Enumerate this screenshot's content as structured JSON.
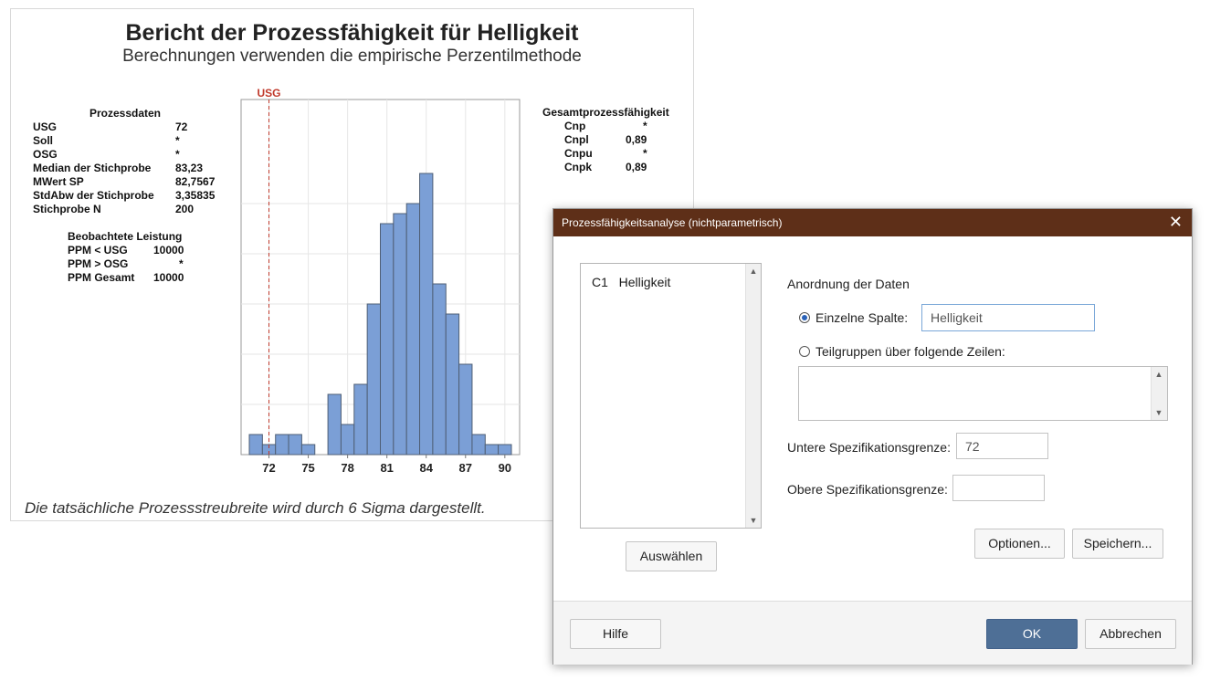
{
  "report": {
    "title": "Bericht der Prozessfähigkeit für Helligkeit",
    "subtitle": "Berechnungen verwenden die empirische Perzentilmethode",
    "process_data": {
      "header": "Prozessdaten",
      "rows": [
        {
          "label": "USG",
          "value": "72"
        },
        {
          "label": "Soll",
          "value": "*"
        },
        {
          "label": "OSG",
          "value": "*"
        },
        {
          "label": "Median der Stichprobe",
          "value": "83,23"
        },
        {
          "label": "MWert SP",
          "value": "82,7567"
        },
        {
          "label": "StdAbw der Stichprobe",
          "value": "3,35835"
        },
        {
          "label": "Stichprobe N",
          "value": "200"
        }
      ]
    },
    "observed": {
      "header": "Beobachtete Leistung",
      "rows": [
        {
          "label": "PPM < USG",
          "value": "10000"
        },
        {
          "label": "PPM > OSG",
          "value": "*"
        },
        {
          "label": "PPM Gesamt",
          "value": "10000"
        }
      ]
    },
    "capability": {
      "header": "Gesamtprozessfähigkeit",
      "rows": [
        {
          "label": "Cnp",
          "value": "*"
        },
        {
          "label": "Cnpl",
          "value": "0,89"
        },
        {
          "label": "Cnpu",
          "value": "*"
        },
        {
          "label": "Cnpk",
          "value": "0,89"
        }
      ]
    },
    "footnote": "Die tatsächliche Prozessstreubreite wird durch 6 Sigma dargestellt."
  },
  "chart_data": {
    "type": "bar",
    "bin_width": 1,
    "bin_starts": [
      70.5,
      71.5,
      72.5,
      73.5,
      74.5,
      75.5,
      76.5,
      77.5,
      78.5,
      79.5,
      80.5,
      81.5,
      82.5,
      83.5,
      84.5,
      85.5,
      86.5,
      87.5,
      88.5,
      89.5
    ],
    "values": [
      2,
      1,
      2,
      2,
      1,
      0,
      6,
      3,
      7,
      15,
      23,
      24,
      25,
      28,
      17,
      14,
      9,
      2,
      1,
      1
    ],
    "xlim": [
      70.5,
      90.5
    ],
    "ylim": [
      0,
      30
    ],
    "xticks": [
      "72",
      "75",
      "78",
      "81",
      "84",
      "87",
      "90"
    ],
    "reference_line": {
      "label": "USG",
      "x": 72,
      "color": "#c0392b"
    },
    "bar_color": "#7b9fd6",
    "bar_edge_color": "#4f5f75"
  },
  "dialog": {
    "title": "Prozessfähigkeitsanalyse (nichtparametrisch)",
    "variables": [
      {
        "id": "C1",
        "name": "Helligkeit"
      }
    ],
    "select_button": "Auswählen",
    "data_arrangement_label": "Anordnung der Daten",
    "single_column": {
      "label": "Einzelne Spalte:",
      "value": "Helligkeit",
      "selected": true
    },
    "subgroups": {
      "label": "Teilgruppen über folgende Zeilen:",
      "selected": false,
      "value": ""
    },
    "lower_spec": {
      "label": "Untere Spezifikationsgrenze:",
      "value": "72"
    },
    "upper_spec": {
      "label": "Obere Spezifikationsgrenze:",
      "value": ""
    },
    "options_button": "Optionen...",
    "save_button": "Speichern...",
    "help_button": "Hilfe",
    "ok_button": "OK",
    "cancel_button": "Abbrechen",
    "close_glyph": "✕"
  }
}
